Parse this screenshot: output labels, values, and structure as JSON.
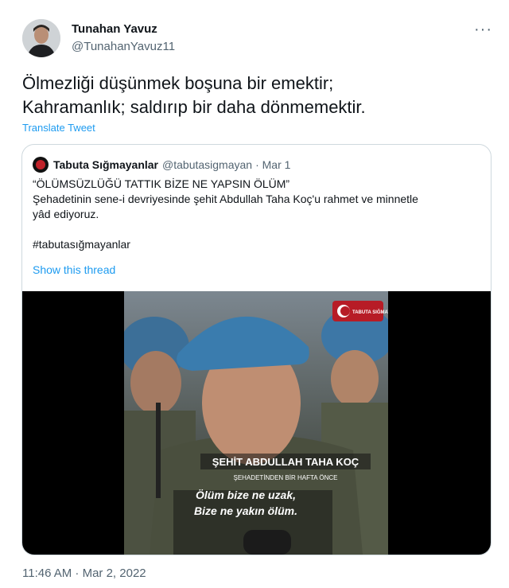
{
  "user": {
    "display_name": "Tunahan Yavuz",
    "handle": "@TunahanYavuz11",
    "avatar_icon": "profile-photo"
  },
  "tweet": {
    "text_line1": "Ölmezliği düşünmek boşuna bir emektir;",
    "text_line2": "Kahramanlık; saldırıp bir daha dönmemektir.",
    "translate_label": "Translate Tweet",
    "timestamp": "11:46 AM · Mar 2, 2022",
    "more_icon": "more-dots-icon"
  },
  "quoted": {
    "display_name": "Tabuta Sığmayanlar",
    "handle": "@tabutasigmayan",
    "date": "· Mar 1",
    "line1": "“ÖLÜMSÜZLÜĞÜ TATTIK BİZE NE YAPSIN ÖLÜM”",
    "line2": "Şehadetinin sene-i devriyesinde şehit Abdullah Taha Koç'u rahmet ve minnetle",
    "line3": "yâd ediyoruz.",
    "hashtag": "#tabutasığmayanlar",
    "show_thread": "Show this thread"
  },
  "video": {
    "logo_text": "TABUTA SIĞMAYANLAR",
    "name_caption": "ŞEHİT ABDULLAH TAHA KOÇ",
    "sub_caption": "ŞEHADETİNDEN BİR HAFTA ÖNCE",
    "subtitle_line1": "Ölüm bize ne uzak,",
    "subtitle_line2": "Bize ne yakın ölüm."
  }
}
